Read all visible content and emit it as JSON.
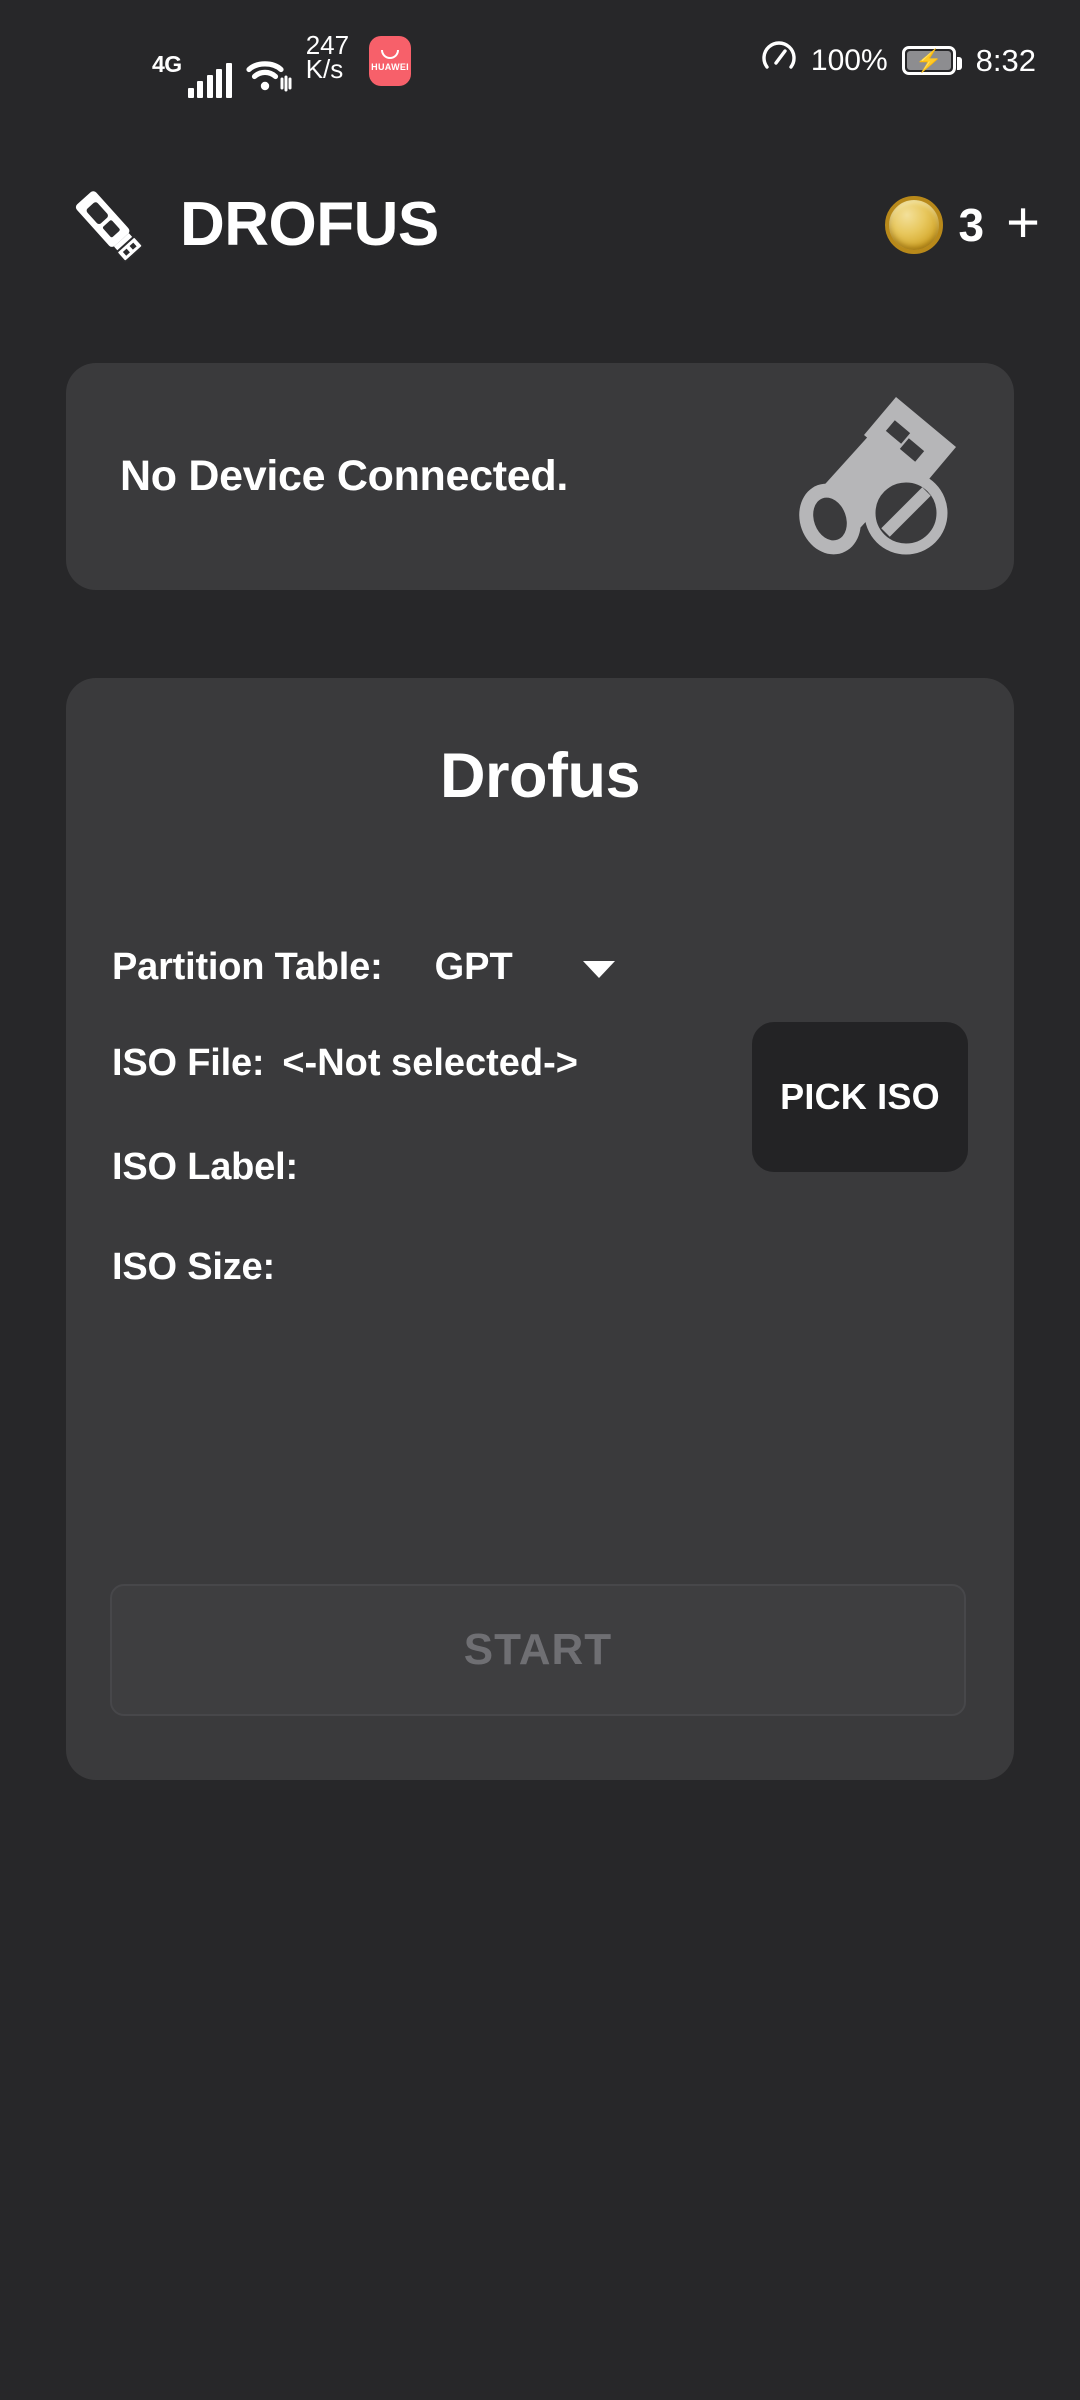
{
  "status_bar": {
    "network_type": "4G",
    "signal_icon": "signal-bars-icon",
    "wifi_icon": "wifi-icon",
    "net_speed_value": "247",
    "net_speed_unit": "K/s",
    "app_badge_label": "HUAWEI",
    "performance_icon": "speedometer-icon",
    "battery_percent": "100%",
    "battery_icon": "battery-charging-icon",
    "time": "8:32"
  },
  "app_bar": {
    "logo_icon": "usb-drive-icon",
    "title": "DROFUS",
    "credits": {
      "coin_icon": "gold-coin-icon",
      "count": "3",
      "add_label": "+"
    }
  },
  "device_card": {
    "status_text": "No Device Connected.",
    "icon": "usb-disconnected-icon"
  },
  "main_card": {
    "title": "Drofus",
    "fields": {
      "partition_table": {
        "label": "Partition Table:",
        "value": "GPT",
        "caret_icon": "chevron-down-icon"
      },
      "iso_file": {
        "label": "ISO File:",
        "value": "<-Not selected->",
        "button_label": "PICK ISO"
      },
      "iso_label": {
        "label": "ISO Label:",
        "value": ""
      },
      "iso_size": {
        "label": "ISO Size:",
        "value": ""
      }
    },
    "start_button": {
      "label": "START",
      "enabled": false
    }
  },
  "colors": {
    "page_background": "#272729",
    "card_background": "#3a3a3c",
    "button_dark": "#232325",
    "text_primary": "#ffffff",
    "text_disabled": "#6f6f73",
    "coin_gold": "#e8c85f",
    "badge_red": "#f7606a",
    "device_icon_gray": "#b6b6b8"
  }
}
